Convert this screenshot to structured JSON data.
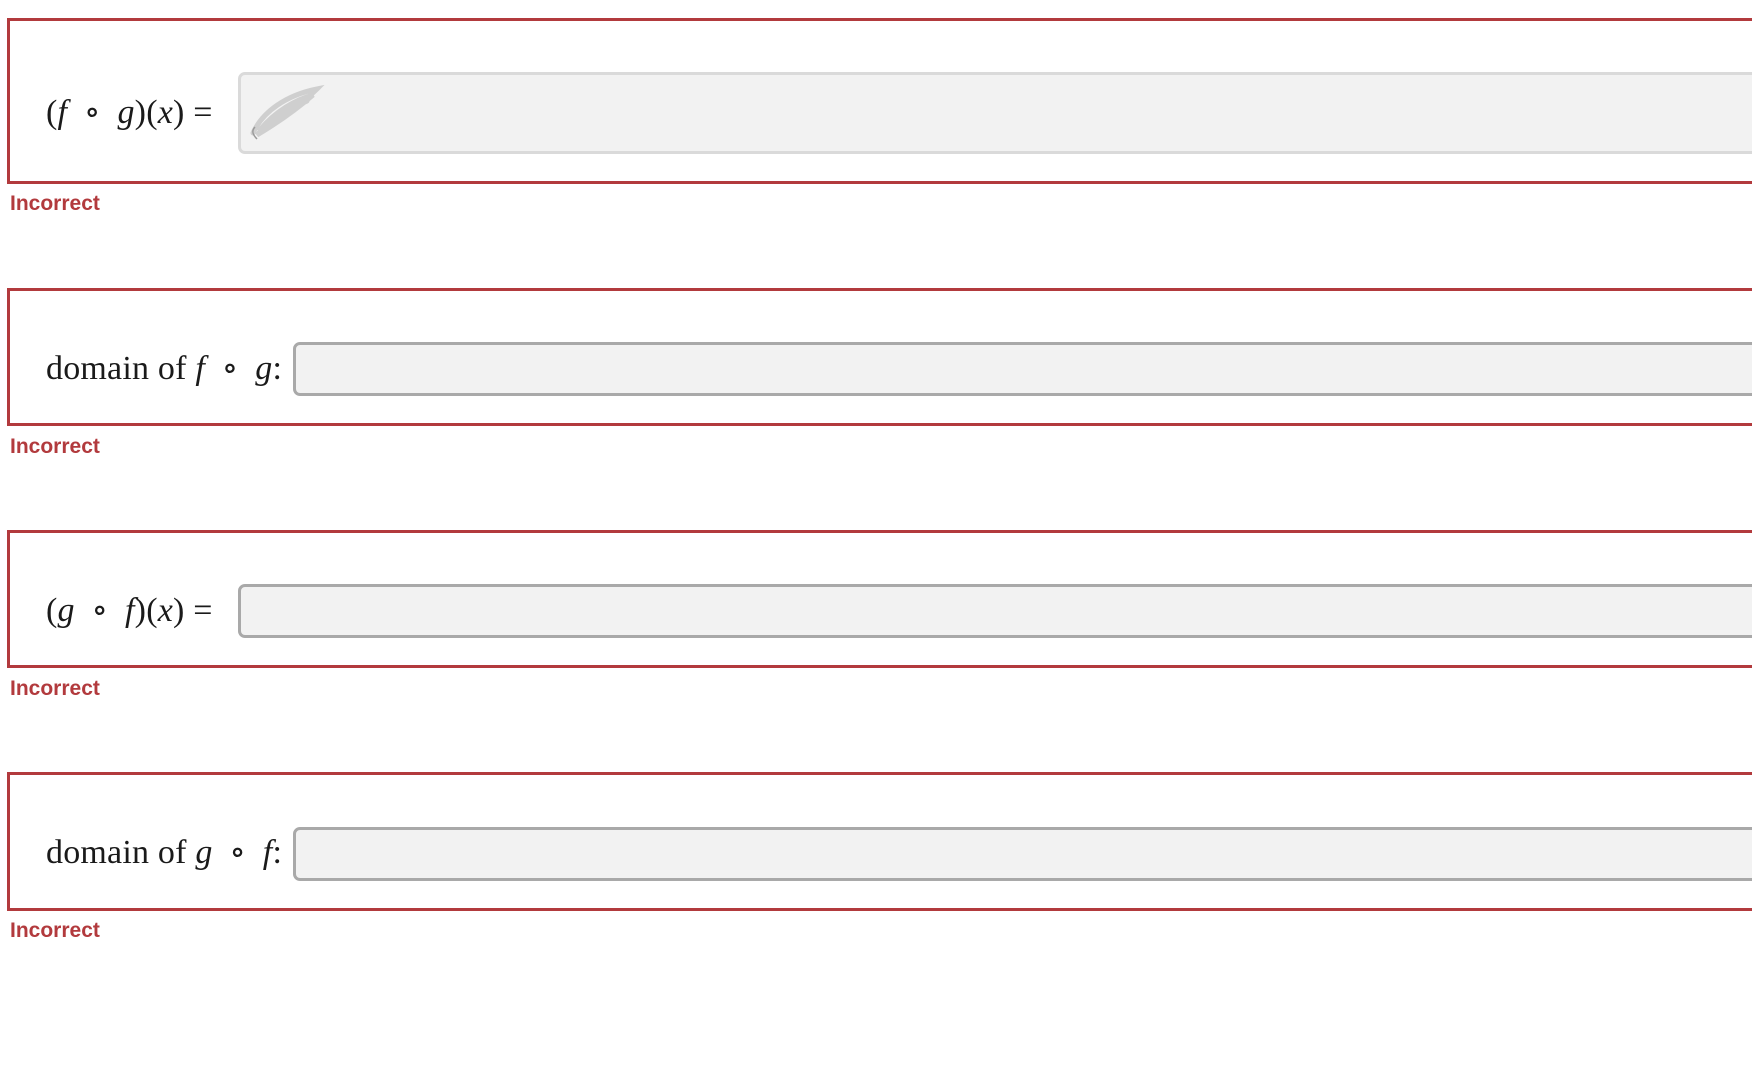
{
  "questions": [
    {
      "id": "fog",
      "label_parts": [
        "(",
        "f",
        " ∘ ",
        "g",
        ")(",
        "x",
        ") ="
      ],
      "input_value": "",
      "input_state": "handwriting-entry",
      "feedback": "Incorrect"
    },
    {
      "id": "domain-fog",
      "label_parts": [
        "domain of ",
        "f",
        " ∘ ",
        "g",
        ":"
      ],
      "input_value": "",
      "input_state": "text-entry",
      "feedback": "Incorrect"
    },
    {
      "id": "gof",
      "label_parts": [
        "(",
        "g",
        " ∘ ",
        "f",
        ")(",
        "x",
        ") ="
      ],
      "input_value": "",
      "input_state": "text-entry",
      "feedback": "Incorrect"
    },
    {
      "id": "domain-gof",
      "label_parts": [
        "domain of ",
        "g",
        " ∘ ",
        "f",
        ":"
      ],
      "input_value": "",
      "input_state": "text-entry",
      "feedback": "Incorrect"
    }
  ],
  "colors": {
    "error_border": "#b23a3d",
    "input_bg": "#f2f2f2",
    "input_border": "#a9a9a9"
  },
  "icons": {
    "handwriting": "pencil-scribble-icon"
  }
}
